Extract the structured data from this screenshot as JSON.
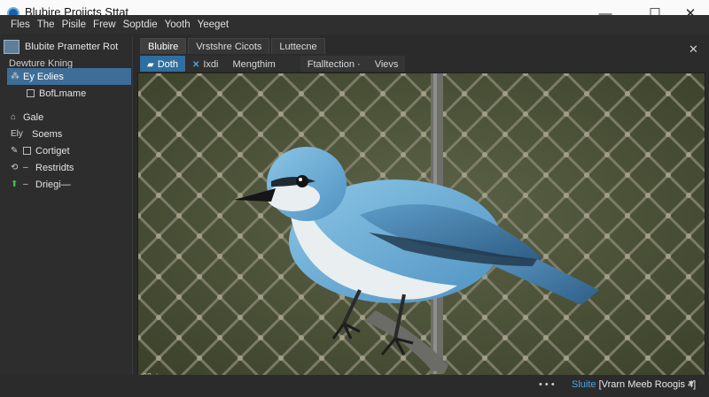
{
  "window": {
    "title": "Blubire Projicts Sttat",
    "minimize_glyph": "—",
    "maximize_glyph": "☐",
    "close_glyph": "✕"
  },
  "menu": [
    "Fles",
    "The",
    "Pisile",
    "Frew",
    "Soptdie",
    "Yooth",
    "Yeeget"
  ],
  "sidebar": {
    "title": "Blubite Prametter Rot",
    "subtitle": "Dewture Kning",
    "items": [
      {
        "label": "Ey Eolies",
        "icon": "tree-icon",
        "selected": true
      },
      {
        "label": "BofLmame",
        "icon": "checkbox-icon",
        "sub": true
      },
      {
        "label": "Gale",
        "icon": "home-icon"
      },
      {
        "label": "Soems",
        "icon": "people-icon",
        "prefix": "Ely"
      },
      {
        "label": "Cortiget",
        "icon": "checkbox-icon",
        "prefix": "✎"
      },
      {
        "label": "Restridts",
        "icon": "dash-icon",
        "prefix": "⟲"
      },
      {
        "label": "Driegi—",
        "icon": "pin-icon",
        "green": true
      }
    ],
    "footer_arrow": "›",
    "footer_plus": "+"
  },
  "tabs_primary": [
    {
      "label": "Blubire",
      "active": true
    },
    {
      "label": "Vrstshre Cicots",
      "active": false
    },
    {
      "label": "Luttecne",
      "active": false
    }
  ],
  "tabs_secondary": [
    {
      "label": "Doth",
      "active": true,
      "icon": "folder-icon"
    },
    {
      "label": "Ixdi",
      "active": false,
      "icon": "x-icon"
    },
    {
      "label": "Mengthim",
      "active": false
    },
    {
      "label": "Ftalltection ·",
      "active": false
    },
    {
      "label": "Vievs",
      "active": false
    }
  ],
  "canvas": {
    "badge": "▯▯ ⁘",
    "bird_color": "#6aaed6"
  },
  "status": {
    "dots": "• • •",
    "accent": "Sluite",
    "text": "[Vrarn Meeb Roogis 4]",
    "arrow": "▼"
  },
  "colors": {
    "accent": "#3e6d97",
    "tab_active": "#2f6e9f",
    "link": "#4aa3e0"
  }
}
